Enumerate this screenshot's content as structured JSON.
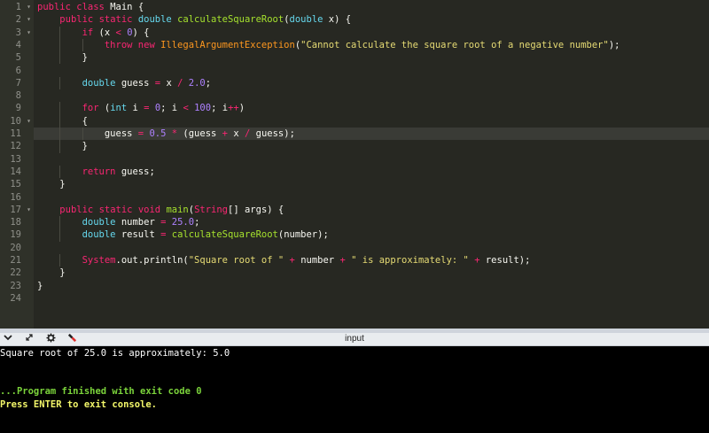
{
  "editor": {
    "lines": [
      "public class Main {",
      "    public static double calculateSquareRoot(double x) {",
      "        if (x < 0) {",
      "            throw new IllegalArgumentException(\"Cannot calculate the square root of a negative number\");",
      "        }",
      "",
      "        double guess = x / 2.0;",
      "",
      "        for (int i = 0; i < 100; i++)",
      "        {",
      "            guess = 0.5 * (guess + x / guess);",
      "        }",
      "",
      "        return guess;",
      "    }",
      "",
      "    public static void main(String[] args) {",
      "        double number = 25.0;",
      "        double result = calculateSquareRoot(number);",
      "",
      "        System.out.println(\"Square root of \" + number + \" is approximately: \" + result);",
      "    }",
      "}",
      ""
    ],
    "line_numbers": [
      "1",
      "2",
      "3",
      "4",
      "5",
      "6",
      "7",
      "8",
      "9",
      "10",
      "11",
      "12",
      "13",
      "14",
      "15",
      "16",
      "17",
      "18",
      "19",
      "20",
      "21",
      "22",
      "23",
      "24"
    ],
    "active_line": "11",
    "colors": {
      "keyword": "#f92672",
      "type": "#66d9ef",
      "number": "#ae81ff",
      "string": "#e6db74",
      "function": "#a6e22e",
      "text": "#f8f8f2",
      "background": "#272822"
    }
  },
  "console_toolbar": {
    "icons": [
      "chevron-down-icon",
      "expand-icon",
      "gear-icon",
      "clear-icon"
    ],
    "label": "input"
  },
  "console": {
    "output": "Square root of 25.0 is approximately: 5.0",
    "status": "...Program finished with exit code 0",
    "prompt": "Press ENTER to exit console."
  }
}
